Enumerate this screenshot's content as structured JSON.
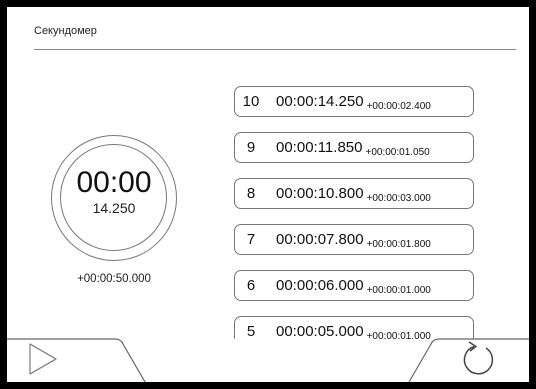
{
  "app": {
    "title": "Секундомер"
  },
  "dial": {
    "main": "00:00",
    "sub": "14.250"
  },
  "total": "+00:00:50.000",
  "laps": [
    {
      "num": "10",
      "time": "00:00:14.250",
      "delta": "+00:00:02.400"
    },
    {
      "num": "9",
      "time": "00:00:11.850",
      "delta": "+00:00:01.050"
    },
    {
      "num": "8",
      "time": "00:00:10.800",
      "delta": "+00:00:03.000"
    },
    {
      "num": "7",
      "time": "00:00:07.800",
      "delta": "+00:00:01.800"
    },
    {
      "num": "6",
      "time": "00:00:06.000",
      "delta": "+00:00:01.000"
    },
    {
      "num": "5",
      "time": "00:00:05.000",
      "delta": "+00:00:01.000"
    }
  ],
  "controls": {
    "play_icon": "play-icon",
    "reset_icon": "reset-icon"
  }
}
